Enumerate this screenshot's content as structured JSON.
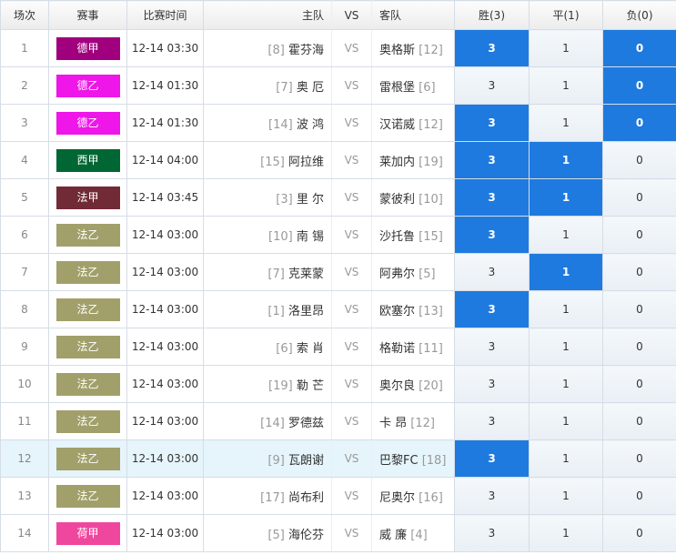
{
  "header": {
    "round": "场次",
    "league": "赛事",
    "time": "比赛时间",
    "home": "主队",
    "vs": "VS",
    "away": "客队",
    "win": "胜(3)",
    "draw": "平(1)",
    "lose": "负(0)"
  },
  "colors": {
    "德甲": "#a0007e",
    "德乙": "#ee16e8",
    "西甲": "#006633",
    "法甲": "#702b36",
    "法乙": "#a1a06b",
    "荷甲": "#f0479e",
    "selected": "#1e7adf"
  },
  "rows": [
    {
      "num": "1",
      "league": "德甲",
      "time": "12-14 03:30",
      "home_rank": "[8]",
      "home": "霍芬海",
      "vs": "VS",
      "away": "奥格斯",
      "away_rank": "[12]",
      "win": "3",
      "draw": "1",
      "lose": "0",
      "sel": [
        true,
        false,
        true
      ],
      "highlight": false
    },
    {
      "num": "2",
      "league": "德乙",
      "time": "12-14 01:30",
      "home_rank": "[7]",
      "home": "奥 厄",
      "vs": "VS",
      "away": "雷根堡",
      "away_rank": "[6]",
      "win": "3",
      "draw": "1",
      "lose": "0",
      "sel": [
        false,
        false,
        true
      ],
      "highlight": false
    },
    {
      "num": "3",
      "league": "德乙",
      "time": "12-14 01:30",
      "home_rank": "[14]",
      "home": "波 鸿",
      "vs": "VS",
      "away": "汉诺威",
      "away_rank": "[12]",
      "win": "3",
      "draw": "1",
      "lose": "0",
      "sel": [
        true,
        false,
        true
      ],
      "highlight": false
    },
    {
      "num": "4",
      "league": "西甲",
      "time": "12-14 04:00",
      "home_rank": "[15]",
      "home": "阿拉维",
      "vs": "VS",
      "away": "莱加内",
      "away_rank": "[19]",
      "win": "3",
      "draw": "1",
      "lose": "0",
      "sel": [
        true,
        true,
        false
      ],
      "highlight": false
    },
    {
      "num": "5",
      "league": "法甲",
      "time": "12-14 03:45",
      "home_rank": "[3]",
      "home": "里 尔",
      "vs": "VS",
      "away": "蒙彼利",
      "away_rank": "[10]",
      "win": "3",
      "draw": "1",
      "lose": "0",
      "sel": [
        true,
        true,
        false
      ],
      "highlight": false
    },
    {
      "num": "6",
      "league": "法乙",
      "time": "12-14 03:00",
      "home_rank": "[10]",
      "home": "南 锡",
      "vs": "VS",
      "away": "沙托鲁",
      "away_rank": "[15]",
      "win": "3",
      "draw": "1",
      "lose": "0",
      "sel": [
        true,
        false,
        false
      ],
      "highlight": false
    },
    {
      "num": "7",
      "league": "法乙",
      "time": "12-14 03:00",
      "home_rank": "[7]",
      "home": "克莱蒙",
      "vs": "VS",
      "away": "阿弗尔",
      "away_rank": "[5]",
      "win": "3",
      "draw": "1",
      "lose": "0",
      "sel": [
        false,
        true,
        false
      ],
      "highlight": false
    },
    {
      "num": "8",
      "league": "法乙",
      "time": "12-14 03:00",
      "home_rank": "[1]",
      "home": "洛里昂",
      "vs": "VS",
      "away": "欧塞尔",
      "away_rank": "[13]",
      "win": "3",
      "draw": "1",
      "lose": "0",
      "sel": [
        true,
        false,
        false
      ],
      "highlight": false
    },
    {
      "num": "9",
      "league": "法乙",
      "time": "12-14 03:00",
      "home_rank": "[6]",
      "home": "索 肖",
      "vs": "VS",
      "away": "格勒诺",
      "away_rank": "[11]",
      "win": "3",
      "draw": "1",
      "lose": "0",
      "sel": [
        false,
        false,
        false
      ],
      "highlight": false
    },
    {
      "num": "10",
      "league": "法乙",
      "time": "12-14 03:00",
      "home_rank": "[19]",
      "home": "勒 芒",
      "vs": "VS",
      "away": "奥尔良",
      "away_rank": "[20]",
      "win": "3",
      "draw": "1",
      "lose": "0",
      "sel": [
        false,
        false,
        false
      ],
      "highlight": false
    },
    {
      "num": "11",
      "league": "法乙",
      "time": "12-14 03:00",
      "home_rank": "[14]",
      "home": "罗德兹",
      "vs": "VS",
      "away": "卡 昂",
      "away_rank": "[12]",
      "win": "3",
      "draw": "1",
      "lose": "0",
      "sel": [
        false,
        false,
        false
      ],
      "highlight": false
    },
    {
      "num": "12",
      "league": "法乙",
      "time": "12-14 03:00",
      "home_rank": "[9]",
      "home": "瓦朗谢",
      "vs": "VS",
      "away": "巴黎FC",
      "away_rank": "[18]",
      "win": "3",
      "draw": "1",
      "lose": "0",
      "sel": [
        true,
        false,
        false
      ],
      "highlight": true
    },
    {
      "num": "13",
      "league": "法乙",
      "time": "12-14 03:00",
      "home_rank": "[17]",
      "home": "尚布利",
      "vs": "VS",
      "away": "尼奥尔",
      "away_rank": "[16]",
      "win": "3",
      "draw": "1",
      "lose": "0",
      "sel": [
        false,
        false,
        false
      ],
      "highlight": false
    },
    {
      "num": "14",
      "league": "荷甲",
      "time": "12-14 03:00",
      "home_rank": "[5]",
      "home": "海伦芬",
      "vs": "VS",
      "away": "威 廉",
      "away_rank": "[4]",
      "win": "3",
      "draw": "1",
      "lose": "0",
      "sel": [
        false,
        false,
        false
      ],
      "highlight": false
    }
  ]
}
